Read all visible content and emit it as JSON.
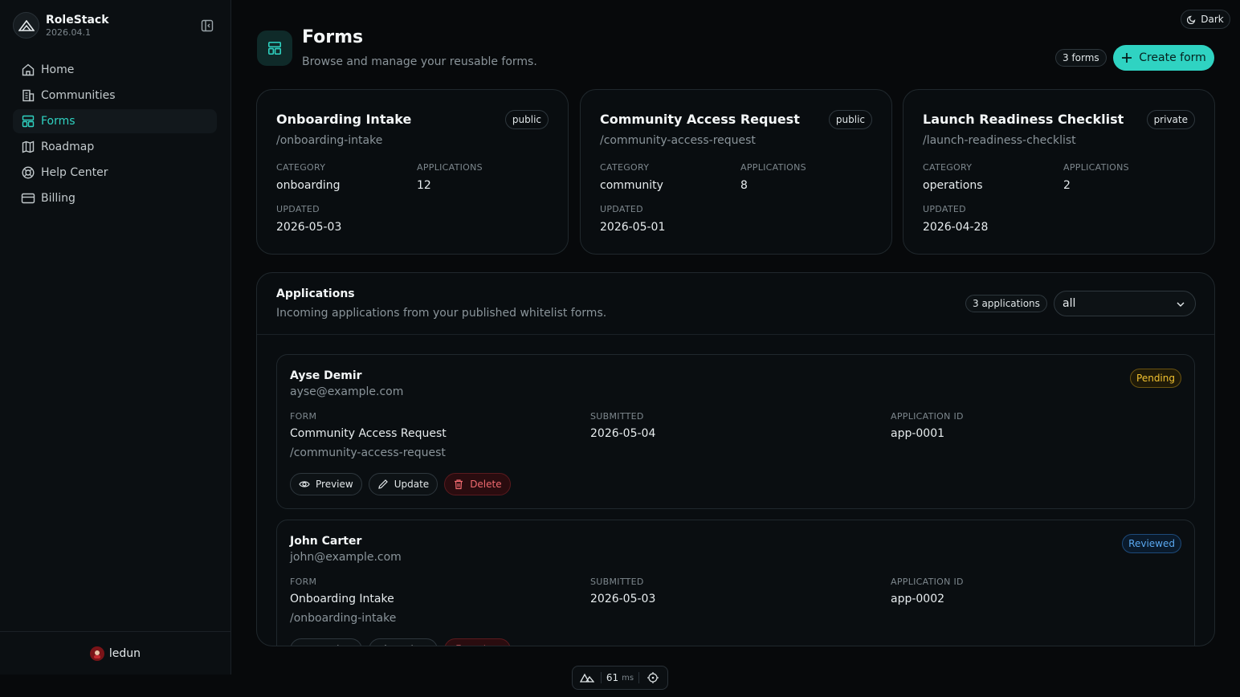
{
  "app": {
    "name": "RoleStack",
    "version": "2026.04.1"
  },
  "sidebar": {
    "items": [
      {
        "label": "Home",
        "icon": "home-icon"
      },
      {
        "label": "Communities",
        "icon": "building-icon"
      },
      {
        "label": "Forms",
        "icon": "layout-icon",
        "active": true
      },
      {
        "label": "Roadmap",
        "icon": "map-icon"
      },
      {
        "label": "Help Center",
        "icon": "lifebuoy-icon"
      },
      {
        "label": "Billing",
        "icon": "credit-card-icon"
      }
    ],
    "user": {
      "name": "ledun"
    }
  },
  "theme": {
    "label": "Dark"
  },
  "header": {
    "title": "Forms",
    "subtitle": "Browse and manage your reusable forms.",
    "count": "3 forms",
    "create_label": "Create form"
  },
  "labels": {
    "category": "CATEGORY",
    "applications": "APPLICATIONS",
    "updated": "UPDATED",
    "form": "FORM",
    "submitted": "SUBMITTED",
    "application_id": "APPLICATION ID"
  },
  "forms": [
    {
      "title": "Onboarding Intake",
      "slug": "/onboarding-intake",
      "visibility": "public",
      "category": "onboarding",
      "applications": "12",
      "updated": "2026-05-03"
    },
    {
      "title": "Community Access Request",
      "slug": "/community-access-request",
      "visibility": "public",
      "category": "community",
      "applications": "8",
      "updated": "2026-05-01"
    },
    {
      "title": "Launch Readiness Checklist",
      "slug": "/launch-readiness-checklist",
      "visibility": "private",
      "category": "operations",
      "applications": "2",
      "updated": "2026-04-28"
    }
  ],
  "applications_panel": {
    "title": "Applications",
    "subtitle": "Incoming applications from your published whitelist forms.",
    "count": "3 applications",
    "filter": "all"
  },
  "applications": [
    {
      "name": "Ayse Demir",
      "email": "ayse@example.com",
      "status": "Pending",
      "form": "Community Access Request",
      "form_slug": "/community-access-request",
      "submitted": "2026-05-04",
      "id": "app-0001"
    },
    {
      "name": "John Carter",
      "email": "john@example.com",
      "status": "Reviewed",
      "form": "Onboarding Intake",
      "form_slug": "/onboarding-intake",
      "submitted": "2026-05-03",
      "id": "app-0002"
    }
  ],
  "actions": {
    "preview": "Preview",
    "update": "Update",
    "delete": "Delete"
  },
  "perf": {
    "value": "61",
    "unit": "ms"
  },
  "colors": {
    "accent": "#2fd3c2",
    "pending": "#f2c230",
    "reviewed": "#5aa8f0",
    "danger": "#f06a6f"
  }
}
